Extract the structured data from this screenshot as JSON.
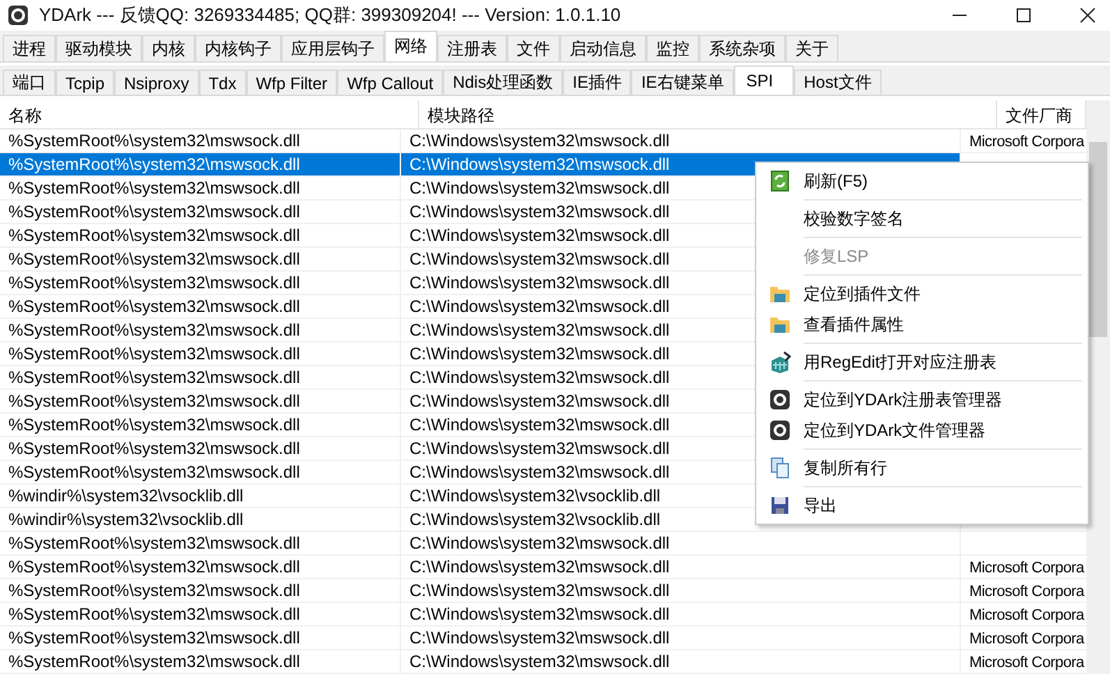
{
  "window": {
    "title": "YDArk --- 反馈QQ: 3269334485; QQ群: 399309204! --- Version: 1.0.1.10"
  },
  "tabs": [
    {
      "label": "进程",
      "selected": false
    },
    {
      "label": "驱动模块",
      "selected": false
    },
    {
      "label": "内核",
      "selected": false
    },
    {
      "label": "内核钩子",
      "selected": false
    },
    {
      "label": "应用层钩子",
      "selected": false
    },
    {
      "label": "网络",
      "selected": true
    },
    {
      "label": "注册表",
      "selected": false
    },
    {
      "label": "文件",
      "selected": false
    },
    {
      "label": "启动信息",
      "selected": false
    },
    {
      "label": "监控",
      "selected": false
    },
    {
      "label": "系统杂项",
      "selected": false
    },
    {
      "label": "关于",
      "selected": false
    }
  ],
  "subtabs": [
    {
      "label": "端口",
      "selected": false
    },
    {
      "label": "Tcpip",
      "selected": false
    },
    {
      "label": "Nsiproxy",
      "selected": false
    },
    {
      "label": "Tdx",
      "selected": false
    },
    {
      "label": "Wfp Filter",
      "selected": false
    },
    {
      "label": "Wfp Callout",
      "selected": false
    },
    {
      "label": "Ndis处理函数",
      "selected": false
    },
    {
      "label": "IE插件",
      "selected": false
    },
    {
      "label": "IE右键菜单",
      "selected": false
    },
    {
      "label": "SPI",
      "selected": true
    },
    {
      "label": "Host文件",
      "selected": false
    }
  ],
  "table": {
    "columns": [
      "名称",
      "模块路径",
      "文件厂商"
    ],
    "rows": [
      {
        "name": "%SystemRoot%\\system32\\mswsock.dll",
        "path": "C:\\Windows\\system32\\mswsock.dll",
        "vendor": "Microsoft Corpora",
        "selected": false
      },
      {
        "name": "%SystemRoot%\\system32\\mswsock.dll",
        "path": "C:\\Windows\\system32\\mswsock.dll",
        "selected": true
      },
      {
        "name": "%SystemRoot%\\system32\\mswsock.dll",
        "path": "C:\\Windows\\system32\\mswsock.dll",
        "selected": false
      },
      {
        "name": "%SystemRoot%\\system32\\mswsock.dll",
        "path": "C:\\Windows\\system32\\mswsock.dll",
        "selected": false
      },
      {
        "name": "%SystemRoot%\\system32\\mswsock.dll",
        "path": "C:\\Windows\\system32\\mswsock.dll",
        "selected": false
      },
      {
        "name": "%SystemRoot%\\system32\\mswsock.dll",
        "path": "C:\\Windows\\system32\\mswsock.dll",
        "selected": false
      },
      {
        "name": "%SystemRoot%\\system32\\mswsock.dll",
        "path": "C:\\Windows\\system32\\mswsock.dll",
        "selected": false
      },
      {
        "name": "%SystemRoot%\\system32\\mswsock.dll",
        "path": "C:\\Windows\\system32\\mswsock.dll",
        "selected": false
      },
      {
        "name": "%SystemRoot%\\system32\\mswsock.dll",
        "path": "C:\\Windows\\system32\\mswsock.dll",
        "selected": false
      },
      {
        "name": "%SystemRoot%\\system32\\mswsock.dll",
        "path": "C:\\Windows\\system32\\mswsock.dll",
        "selected": false
      },
      {
        "name": "%SystemRoot%\\system32\\mswsock.dll",
        "path": "C:\\Windows\\system32\\mswsock.dll",
        "selected": false
      },
      {
        "name": "%SystemRoot%\\system32\\mswsock.dll",
        "path": "C:\\Windows\\system32\\mswsock.dll",
        "selected": false
      },
      {
        "name": "%SystemRoot%\\system32\\mswsock.dll",
        "path": "C:\\Windows\\system32\\mswsock.dll",
        "selected": false
      },
      {
        "name": "%SystemRoot%\\system32\\mswsock.dll",
        "path": "C:\\Windows\\system32\\mswsock.dll",
        "selected": false
      },
      {
        "name": "%SystemRoot%\\system32\\mswsock.dll",
        "path": "C:\\Windows\\system32\\mswsock.dll",
        "selected": false
      },
      {
        "name": "%windir%\\system32\\vsocklib.dll",
        "path": "C:\\Windows\\system32\\vsocklib.dll",
        "selected": false
      },
      {
        "name": "%windir%\\system32\\vsocklib.dll",
        "path": "C:\\Windows\\system32\\vsocklib.dll",
        "selected": false
      },
      {
        "name": "%SystemRoot%\\system32\\mswsock.dll",
        "path": "C:\\Windows\\system32\\mswsock.dll",
        "selected": false
      },
      {
        "name": "%SystemRoot%\\system32\\mswsock.dll",
        "path": "C:\\Windows\\system32\\mswsock.dll",
        "vendor": "Microsoft Corpora",
        "selected": false
      },
      {
        "name": "%SystemRoot%\\system32\\mswsock.dll",
        "path": "C:\\Windows\\system32\\mswsock.dll",
        "vendor": "Microsoft Corpora",
        "selected": false
      },
      {
        "name": "%SystemRoot%\\system32\\mswsock.dll",
        "path": "C:\\Windows\\system32\\mswsock.dll",
        "vendor": "Microsoft Corpora",
        "selected": false
      },
      {
        "name": "%SystemRoot%\\system32\\mswsock.dll",
        "path": "C:\\Windows\\system32\\mswsock.dll",
        "vendor": "Microsoft Corpora",
        "selected": false
      },
      {
        "name": "%SystemRoot%\\system32\\mswsock.dll",
        "path": "C:\\Windows\\system32\\mswsock.dll",
        "vendor": "Microsoft Corpora",
        "selected": false
      }
    ]
  },
  "context_menu": {
    "groups": [
      [
        {
          "label": "刷新(F5)",
          "kind": "refresh",
          "disabled": false
        }
      ],
      [
        {
          "label": "校验数字签名",
          "kind": "plain",
          "disabled": false
        }
      ],
      [
        {
          "label": "修复LSP",
          "kind": "plain",
          "disabled": true
        }
      ],
      [
        {
          "label": "定位到插件文件",
          "kind": "folder",
          "disabled": false
        },
        {
          "label": "查看插件属性",
          "kind": "folder",
          "disabled": false
        }
      ],
      [
        {
          "label": "用RegEdit打开对应注册表",
          "kind": "regedit",
          "disabled": false
        }
      ],
      [
        {
          "label": "定位到YDArk注册表管理器",
          "kind": "gear",
          "disabled": false
        },
        {
          "label": "定位到YDArk文件管理器",
          "kind": "gear",
          "disabled": false
        }
      ],
      [
        {
          "label": "复制所有行",
          "kind": "copy",
          "disabled": false
        }
      ],
      [
        {
          "label": "导出",
          "kind": "save",
          "disabled": false
        }
      ]
    ]
  }
}
